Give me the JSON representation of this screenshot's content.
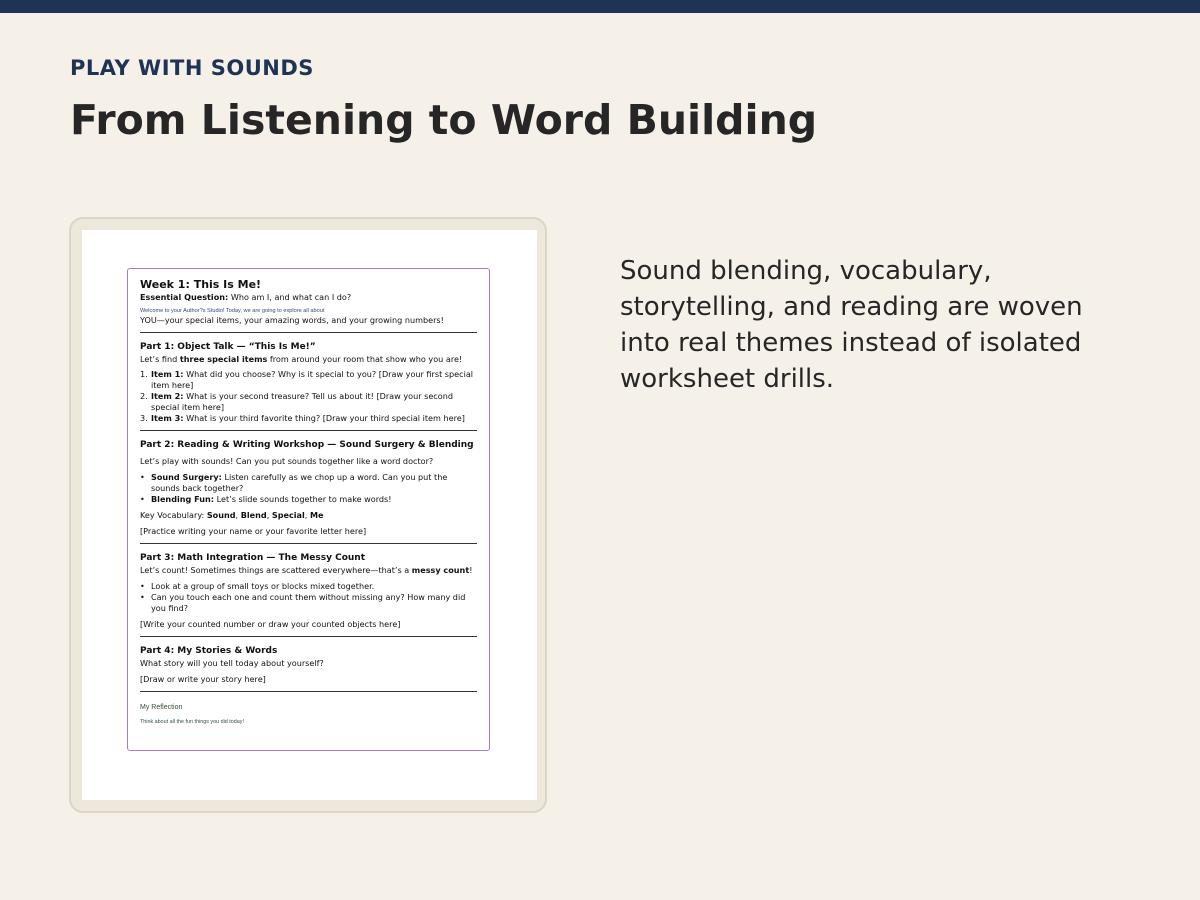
{
  "slide": {
    "eyebrow": "PLAY WITH SOUNDS",
    "title": "From Listening to Word Building",
    "body": "Sound blending, vocabulary, storytelling, and reading are woven into real themes instead of isolated worksheet drills."
  },
  "document": {
    "title": "Week 1: This Is Me!",
    "eq_label": "Essential Question:",
    "eq_text": " Who am I, and what can I do?",
    "welcome_tiny": "Welcome to your Author?s Studio! Today, we are going to explore all about",
    "welcome_line": "YOU—your special items, your amazing words, and your growing numbers!",
    "part1": {
      "title": "Part 1: Object Talk — “This Is Me!”",
      "intro_pre": "Let’s find ",
      "intro_bold": "three special items",
      "intro_post": " from around your room that show who you are!",
      "items": [
        {
          "num": "1.",
          "label": "Item 1:",
          "text": " What did you choose? Why is it special to you? [Draw your first special item here]"
        },
        {
          "num": "2.",
          "label": "Item 2:",
          "text": " What is your second treasure? Tell us about it! [Draw your second special item here]"
        },
        {
          "num": "3.",
          "label": "Item 3:",
          "text": " What is your third favorite thing? [Draw your third special item here]"
        }
      ]
    },
    "part2": {
      "title": "Part 2: Reading & Writing Workshop — Sound Surgery & Blending",
      "intro": "Let’s play with sounds! Can you put sounds together like a word doctor?",
      "bullets": [
        {
          "label": "Sound Surgery:",
          "text": " Listen carefully as we chop up a word. Can you put the sounds back together?"
        },
        {
          "label": "Blending Fun:",
          "text": " Let’s slide sounds together to make words!"
        }
      ],
      "vocab_label": "Key Vocabulary: ",
      "vocab": [
        "Sound",
        "Blend",
        "Special",
        "Me"
      ],
      "practice": "[Practice writing your name or your favorite letter here]"
    },
    "part3": {
      "title": "Part 3: Math Integration — The Messy Count",
      "intro_pre": "Let’s count! Sometimes things are scattered everywhere—that’s a ",
      "intro_bold": "messy count",
      "intro_post": "!",
      "bullets": [
        "Look at a group of small toys or blocks mixed together.",
        "Can you touch each one and count them without missing any? How many did you find?"
      ],
      "prompt": "[Write your counted number or draw your counted objects here]"
    },
    "part4": {
      "title": "Part 4: My Stories & Words",
      "intro": "What story will you tell today about yourself?",
      "prompt": "[Draw or write your story here]"
    },
    "reflection": {
      "title": "My Reflection",
      "subtitle": "Think about all the fun things you did today!"
    }
  }
}
